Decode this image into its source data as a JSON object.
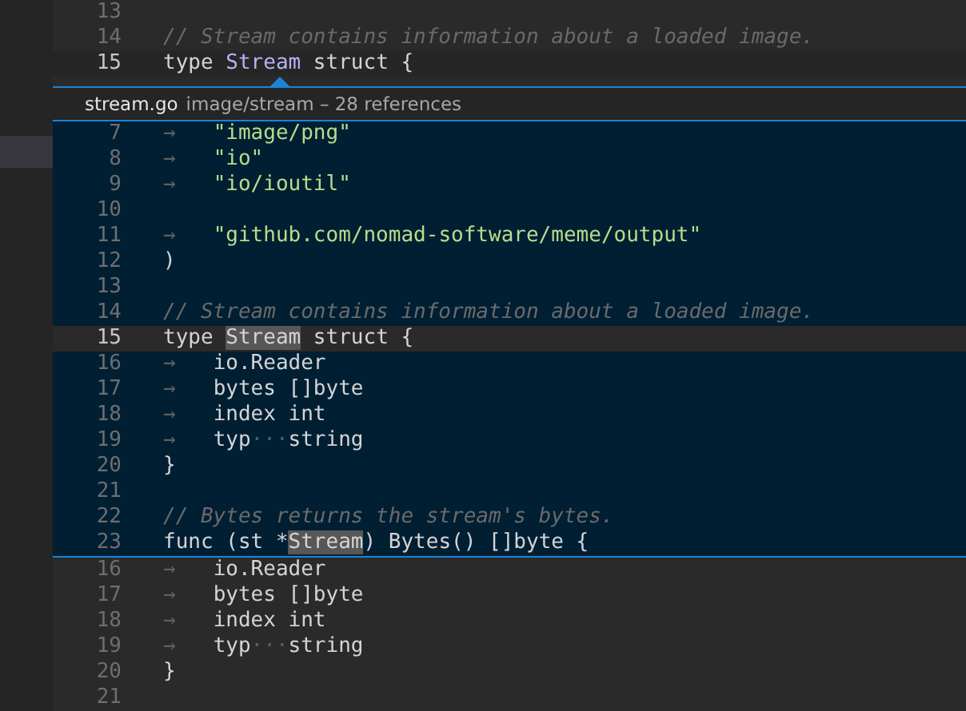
{
  "editor_top": {
    "lines": [
      {
        "number": "13",
        "current": false
      },
      {
        "number": "14",
        "current": false,
        "tokens": [
          {
            "kind": "comment",
            "text": "// Stream contains information about a loaded image."
          }
        ]
      },
      {
        "number": "15",
        "current": true,
        "tokens": [
          {
            "kind": "code",
            "text": "type "
          },
          {
            "kind": "type",
            "text": "Stream"
          },
          {
            "kind": "code",
            "text": " struct {"
          }
        ]
      }
    ]
  },
  "peek": {
    "file": "stream.go",
    "detail": "image/stream – 28 references",
    "lines": [
      {
        "number": "7",
        "current": false,
        "tokens": [
          {
            "kind": "ws",
            "text": "→   "
          },
          {
            "kind": "string",
            "text": "\"image/png\""
          }
        ]
      },
      {
        "number": "8",
        "current": false,
        "tokens": [
          {
            "kind": "ws",
            "text": "→   "
          },
          {
            "kind": "string",
            "text": "\"io\""
          }
        ]
      },
      {
        "number": "9",
        "current": false,
        "tokens": [
          {
            "kind": "ws",
            "text": "→   "
          },
          {
            "kind": "string",
            "text": "\"io/ioutil\""
          }
        ]
      },
      {
        "number": "10",
        "current": false
      },
      {
        "number": "11",
        "current": false,
        "tokens": [
          {
            "kind": "ws",
            "text": "→   "
          },
          {
            "kind": "string",
            "text": "\"github.com/nomad-software/meme/output\""
          }
        ]
      },
      {
        "number": "12",
        "current": false,
        "tokens": [
          {
            "kind": "code",
            "text": ")"
          }
        ]
      },
      {
        "number": "13",
        "current": false
      },
      {
        "number": "14",
        "current": false,
        "tokens": [
          {
            "kind": "comment",
            "text": "// Stream contains information about a loaded image."
          }
        ]
      },
      {
        "number": "15",
        "current": true,
        "tokens": [
          {
            "kind": "code",
            "text": "type "
          },
          {
            "kind": "match",
            "text": "Stream"
          },
          {
            "kind": "code",
            "text": " struct {"
          }
        ]
      },
      {
        "number": "16",
        "current": false,
        "tokens": [
          {
            "kind": "ws",
            "text": "→   "
          },
          {
            "kind": "code",
            "text": "io.Reader"
          }
        ]
      },
      {
        "number": "17",
        "current": false,
        "tokens": [
          {
            "kind": "ws",
            "text": "→   "
          },
          {
            "kind": "code",
            "text": "bytes []byte"
          }
        ]
      },
      {
        "number": "18",
        "current": false,
        "tokens": [
          {
            "kind": "ws",
            "text": "→   "
          },
          {
            "kind": "code",
            "text": "index int"
          }
        ]
      },
      {
        "number": "19",
        "current": false,
        "tokens": [
          {
            "kind": "ws",
            "text": "→   "
          },
          {
            "kind": "code",
            "text": "typ"
          },
          {
            "kind": "ws",
            "text": "···"
          },
          {
            "kind": "code",
            "text": "string"
          }
        ]
      },
      {
        "number": "20",
        "current": false,
        "tokens": [
          {
            "kind": "code",
            "text": "}"
          }
        ]
      },
      {
        "number": "21",
        "current": false
      },
      {
        "number": "22",
        "current": false,
        "tokens": [
          {
            "kind": "comment",
            "text": "// Bytes returns the stream's bytes."
          }
        ]
      },
      {
        "number": "23",
        "current": false,
        "tokens": [
          {
            "kind": "code",
            "text": "func (st *"
          },
          {
            "kind": "match",
            "text": "Stream"
          },
          {
            "kind": "code",
            "text": ") Bytes() []byte {"
          }
        ]
      }
    ]
  },
  "editor_bottom": {
    "lines": [
      {
        "number": "16",
        "current": false,
        "tokens": [
          {
            "kind": "ws",
            "text": "→   "
          },
          {
            "kind": "code",
            "text": "io.Reader"
          }
        ]
      },
      {
        "number": "17",
        "current": false,
        "tokens": [
          {
            "kind": "ws",
            "text": "→   "
          },
          {
            "kind": "code",
            "text": "bytes []byte"
          }
        ]
      },
      {
        "number": "18",
        "current": false,
        "tokens": [
          {
            "kind": "ws",
            "text": "→   "
          },
          {
            "kind": "code",
            "text": "index int"
          }
        ]
      },
      {
        "number": "19",
        "current": false,
        "tokens": [
          {
            "kind": "ws",
            "text": "→   "
          },
          {
            "kind": "code",
            "text": "typ"
          },
          {
            "kind": "ws",
            "text": "···"
          },
          {
            "kind": "code",
            "text": "string"
          }
        ]
      },
      {
        "number": "20",
        "current": false,
        "tokens": [
          {
            "kind": "code",
            "text": "}"
          }
        ]
      },
      {
        "number": "21",
        "current": false
      }
    ]
  }
}
